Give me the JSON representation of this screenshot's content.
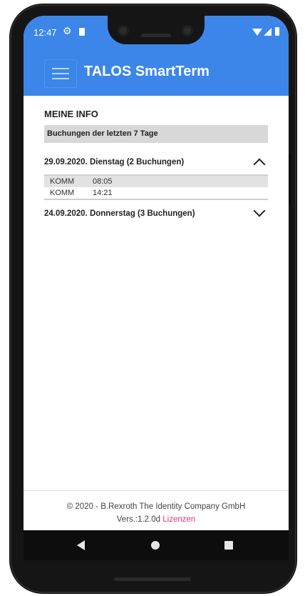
{
  "status": {
    "time": "12:47"
  },
  "appbar": {
    "title": "TALOS SmartTerm"
  },
  "info": {
    "section_title": "MEINE INFO",
    "subtitle": "Buchungen der letzten 7 Tage",
    "days": [
      {
        "label": "29.09.2020. Dienstag (2 Buchungen)",
        "expanded": true,
        "bookings": [
          {
            "type": "KOMM",
            "time": "08:05"
          },
          {
            "type": "KOMM",
            "time": "14:21"
          }
        ]
      },
      {
        "label": "24.09.2020. Donnerstag (3 Buchungen)",
        "expanded": false,
        "bookings": []
      }
    ]
  },
  "footer": {
    "copyright": "© 2020 - B.Rexroth The Identity Company GmbH",
    "version": "Vers.:1.2.0d",
    "license_link": "Lizenzen"
  },
  "colors": {
    "primary": "#3b86e8",
    "link": "#e5337a",
    "header_bg": "#d8d8d8"
  },
  "icons": {
    "menu": "hamburger-icon",
    "expand": "chevron-up-icon",
    "collapse": "chevron-down-icon",
    "nav": [
      "back-icon",
      "home-icon",
      "recents-icon"
    ]
  }
}
